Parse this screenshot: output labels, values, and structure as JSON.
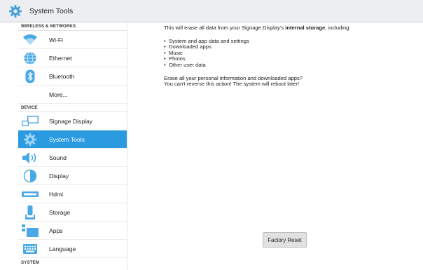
{
  "app_bar": {
    "title": "System Tools",
    "icon": "gear-icon"
  },
  "sidebar": {
    "sections": {
      "wireless": "WIRELESS & NETWORKS",
      "device": "DEVICE",
      "system": "SYSTEM"
    },
    "items": [
      {
        "label": "Wi-Fi",
        "icon": "wifi-icon"
      },
      {
        "label": "Ethernet",
        "icon": "globe-icon"
      },
      {
        "label": "Bluetooth",
        "icon": "bluetooth-icon"
      },
      {
        "label": "More..."
      },
      {
        "label": "Signage Display",
        "icon": "display-screens-icon"
      },
      {
        "label": "System Tools",
        "icon": "gear-icon",
        "selected": true
      },
      {
        "label": "Sound",
        "icon": "speaker-icon"
      },
      {
        "label": "Display",
        "icon": "brightness-icon"
      },
      {
        "label": "Hdmi",
        "icon": "hdmi-icon"
      },
      {
        "label": "Storage",
        "icon": "storage-icon"
      },
      {
        "label": "Apps",
        "icon": "apps-icon"
      },
      {
        "label": "Language",
        "icon": "keyboard-icon"
      }
    ]
  },
  "content": {
    "intro_before": "This will erase all data from your Signage Display's ",
    "intro_bold": "internal storage",
    "intro_after": ", including:",
    "bullets": [
      "System and app data and settings",
      "Downloaded apps",
      "Music",
      "Photos",
      "Other user data"
    ],
    "question_line1": "Erase all your personal information and downloaded apps?",
    "question_line2": "You can't reverse this action! The system will reboot later!",
    "button_label": "Factory Reset"
  },
  "colors": {
    "accent": "#2a9be0",
    "app_bar": "#eceef1"
  }
}
